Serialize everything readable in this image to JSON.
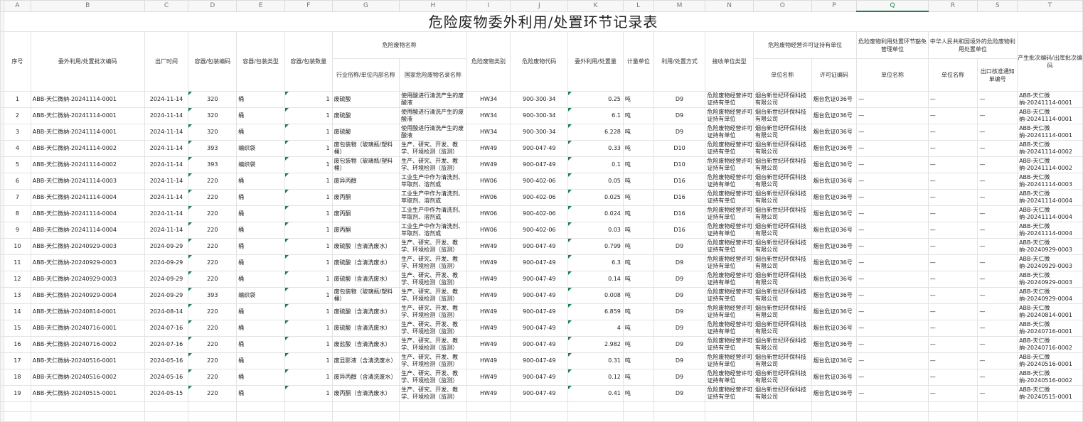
{
  "sheet": {
    "column_letters": [
      "A",
      "B",
      "C",
      "D",
      "E",
      "F",
      "G",
      "H",
      "I",
      "J",
      "K",
      "L",
      "M",
      "N",
      "O",
      "P",
      "Q",
      "R",
      "S",
      "T"
    ],
    "selected_column": "Q",
    "title": "危险废物委外利用/处置环节记录表"
  },
  "headers": {
    "seq": "序号",
    "batch": "委外利用/处置批次编码",
    "date": "出厂时间",
    "container_code": "容器/包装编码",
    "container_type": "容器/包装类型",
    "container_qty": "容器/包装数量",
    "waste_name_group": "危险废物名称",
    "industry_name": "行业俗称/单位内部名称",
    "national_name": "国家危险废物名录名称",
    "category": "危险废物类别",
    "code": "危险废物代码",
    "amount": "委外利用/处置量",
    "unit": "计量单位",
    "method": "利用/处置方式",
    "receiver_type": "接收单位类型",
    "license_group": "危险废物经营许可证持有单位",
    "license_unit_name": "单位名称",
    "license_no": "许可证编码",
    "exempt_group": "危险废物利用处置环节豁免管理单位",
    "exempt_unit_name": "单位名称",
    "foreign_group": "中华人民共和国境外的危险废物利用处置单位",
    "foreign_unit_name": "单位名称",
    "export_notice": "出口核准通知单编号",
    "production_batch": "产生批次编码/出库批次编码"
  },
  "rows": [
    {
      "seq": "1",
      "batch": "ABB-天仁微纳-20241114-0001",
      "date": "2024-11-14",
      "code_c": "320",
      "type": "桶",
      "qty": "1",
      "industry": "废硫酸",
      "national": "使用酸进行清洗产生的废酸液",
      "cat": "HW34",
      "wcode": "900-300-34",
      "amount": "0.25",
      "unit": "吨",
      "method": "D9",
      "receiver": "危险废物经营许可证持有单位",
      "lunit": "烟台新世纪环保科技有限公司",
      "lno": "烟台危证036号",
      "eunit": "—",
      "funit": "—",
      "notice": "—",
      "pbatch": "ABB-天仁微纳-20241114-0001"
    },
    {
      "seq": "2",
      "batch": "ABB-天仁微纳-20241114-0001",
      "date": "2024-11-14",
      "code_c": "320",
      "type": "桶",
      "qty": "1",
      "industry": "废硫酸",
      "national": "使用酸进行清洗产生的废酸液",
      "cat": "HW34",
      "wcode": "900-300-34",
      "amount": "6.1",
      "unit": "吨",
      "method": "D9",
      "receiver": "危险废物经营许可证持有单位",
      "lunit": "烟台新世纪环保科技有限公司",
      "lno": "烟台危证036号",
      "eunit": "—",
      "funit": "—",
      "notice": "—",
      "pbatch": "ABB-天仁微纳-20241114-0001"
    },
    {
      "seq": "3",
      "batch": "ABB-天仁微纳-20241114-0001",
      "date": "2024-11-14",
      "code_c": "320",
      "type": "桶",
      "qty": "1",
      "industry": "废硫酸",
      "national": "使用酸进行清洗产生的废酸液",
      "cat": "HW34",
      "wcode": "900-300-34",
      "amount": "6.228",
      "unit": "吨",
      "method": "D9",
      "receiver": "危险废物经营许可证持有单位",
      "lunit": "烟台新世纪环保科技有限公司",
      "lno": "烟台危证036号",
      "eunit": "—",
      "funit": "—",
      "notice": "—",
      "pbatch": "ABB-天仁微纳-20241114-0001"
    },
    {
      "seq": "4",
      "batch": "ABB-天仁微纳-20241114-0002",
      "date": "2024-11-14",
      "code_c": "393",
      "type": "编织袋",
      "qty": "1",
      "industry": "废包装物（玻璃瓶/塑料桶）",
      "national": "生产、研究、开发、教学、环境检测（监测）",
      "cat": "HW49",
      "wcode": "900-047-49",
      "amount": "0.33",
      "unit": "吨",
      "method": "D10",
      "receiver": "危险废物经营许可证持有单位",
      "lunit": "烟台新世纪环保科技有限公司",
      "lno": "烟台危证036号",
      "eunit": "—",
      "funit": "—",
      "notice": "—",
      "pbatch": "ABB-天仁微纳-20241114-0002"
    },
    {
      "seq": "5",
      "batch": "ABB-天仁微纳-20241114-0002",
      "date": "2024-11-14",
      "code_c": "393",
      "type": "编织袋",
      "qty": "1",
      "industry": "废包装物（玻璃瓶/塑料桶）",
      "national": "生产、研究、开发、教学、环境检测（监测）",
      "cat": "HW49",
      "wcode": "900-047-49",
      "amount": "0.1",
      "unit": "吨",
      "method": "D10",
      "receiver": "危险废物经营许可证持有单位",
      "lunit": "烟台新世纪环保科技有限公司",
      "lno": "烟台危证036号",
      "eunit": "—",
      "funit": "—",
      "notice": "—",
      "pbatch": "ABB-天仁微纳-20241114-0002"
    },
    {
      "seq": "6",
      "batch": "ABB-天仁微纳-20241114-0003",
      "date": "2024-11-14",
      "code_c": "220",
      "type": "桶",
      "qty": "1",
      "industry": "废异丙醇",
      "national": "工业生产中作为清洗剂、萃取剂、溶剂或",
      "cat": "HW06",
      "wcode": "900-402-06",
      "amount": "0.05",
      "unit": "吨",
      "method": "D16",
      "receiver": "危险废物经营许可证持有单位",
      "lunit": "烟台新世纪环保科技有限公司",
      "lno": "烟台危证036号",
      "eunit": "—",
      "funit": "—",
      "notice": "—",
      "pbatch": "ABB-天仁微纳-20241114-0003"
    },
    {
      "seq": "7",
      "batch": "ABB-天仁微纳-20241114-0004",
      "date": "2024-11-14",
      "code_c": "220",
      "type": "桶",
      "qty": "1",
      "industry": "废丙酮",
      "national": "工业生产中作为清洗剂、萃取剂、溶剂或",
      "cat": "HW06",
      "wcode": "900-402-06",
      "amount": "0.025",
      "unit": "吨",
      "method": "D16",
      "receiver": "危险废物经营许可证持有单位",
      "lunit": "烟台新世纪环保科技有限公司",
      "lno": "烟台危证036号",
      "eunit": "—",
      "funit": "—",
      "notice": "—",
      "pbatch": "ABB-天仁微纳-20241114-0004"
    },
    {
      "seq": "8",
      "batch": "ABB-天仁微纳-20241114-0004",
      "date": "2024-11-14",
      "code_c": "220",
      "type": "桶",
      "qty": "1",
      "industry": "废丙酮",
      "national": "工业生产中作为清洗剂、萃取剂、溶剂或",
      "cat": "HW06",
      "wcode": "900-402-06",
      "amount": "0.024",
      "unit": "吨",
      "method": "D16",
      "receiver": "危险废物经营许可证持有单位",
      "lunit": "烟台新世纪环保科技有限公司",
      "lno": "烟台危证036号",
      "eunit": "—",
      "funit": "—",
      "notice": "—",
      "pbatch": "ABB-天仁微纳-20241114-0004"
    },
    {
      "seq": "9",
      "batch": "ABB-天仁微纳-20241114-0004",
      "date": "2024-11-14",
      "code_c": "220",
      "type": "桶",
      "qty": "1",
      "industry": "废丙酮",
      "national": "工业生产中作为清洗剂、萃取剂、溶剂或",
      "cat": "HW06",
      "wcode": "900-402-06",
      "amount": "0.03",
      "unit": "吨",
      "method": "D16",
      "receiver": "危险废物经营许可证持有单位",
      "lunit": "烟台新世纪环保科技有限公司",
      "lno": "烟台危证036号",
      "eunit": "—",
      "funit": "—",
      "notice": "—",
      "pbatch": "ABB-天仁微纳-20241114-0004"
    },
    {
      "seq": "10",
      "batch": "ABB-天仁微纳-20240929-0003",
      "date": "2024-09-29",
      "code_c": "220",
      "type": "桶",
      "qty": "1",
      "industry": "废硫酸（含清洗废水）",
      "national": "生产、研究、开发、教学、环境检测（监测）",
      "cat": "HW49",
      "wcode": "900-047-49",
      "amount": "0.799",
      "unit": "吨",
      "method": "D9",
      "receiver": "危险废物经营许可证持有单位",
      "lunit": "烟台新世纪环保科技有限公司",
      "lno": "烟台危证036号",
      "eunit": "—",
      "funit": "—",
      "notice": "—",
      "pbatch": "ABB-天仁微纳-20240929-0003"
    },
    {
      "seq": "11",
      "batch": "ABB-天仁微纳-20240929-0003",
      "date": "2024-09-29",
      "code_c": "220",
      "type": "桶",
      "qty": "1",
      "industry": "废硫酸（含清洗废水）",
      "national": "生产、研究、开发、教学、环境检测（监测）",
      "cat": "HW49",
      "wcode": "900-047-49",
      "amount": "6.3",
      "unit": "吨",
      "method": "D9",
      "receiver": "危险废物经营许可证持有单位",
      "lunit": "烟台新世纪环保科技有限公司",
      "lno": "烟台危证036号",
      "eunit": "—",
      "funit": "—",
      "notice": "—",
      "pbatch": "ABB-天仁微纳-20240929-0003"
    },
    {
      "seq": "12",
      "batch": "ABB-天仁微纳-20240929-0003",
      "date": "2024-09-29",
      "code_c": "220",
      "type": "桶",
      "qty": "1",
      "industry": "废硫酸（含清洗废水）",
      "national": "生产、研究、开发、教学、环境检测（监测）",
      "cat": "HW49",
      "wcode": "900-047-49",
      "amount": "0.14",
      "unit": "吨",
      "method": "D9",
      "receiver": "危险废物经营许可证持有单位",
      "lunit": "烟台新世纪环保科技有限公司",
      "lno": "烟台危证036号",
      "eunit": "—",
      "funit": "—",
      "notice": "—",
      "pbatch": "ABB-天仁微纳-20240929-0003"
    },
    {
      "seq": "13",
      "batch": "ABB-天仁微纳-20240929-0004",
      "date": "2024-09-29",
      "code_c": "393",
      "type": "编织袋",
      "qty": "1",
      "industry": "废包装物（玻璃瓶/塑料桶）",
      "national": "生产、研究、开发、教学、环境检测（监测）",
      "cat": "HW49",
      "wcode": "900-047-49",
      "amount": "0.008",
      "unit": "吨",
      "method": "D9",
      "receiver": "危险废物经营许可证持有单位",
      "lunit": "烟台新世纪环保科技有限公司",
      "lno": "烟台危证036号",
      "eunit": "—",
      "funit": "—",
      "notice": "—",
      "pbatch": "ABB-天仁微纳-20240929-0004"
    },
    {
      "seq": "14",
      "batch": "ABB-天仁微纳-20240814-0001",
      "date": "2024-08-14",
      "code_c": "220",
      "type": "桶",
      "qty": "1",
      "industry": "废硫酸（含清洗废水）",
      "national": "生产、研究、开发、教学、环境检测（监测）",
      "cat": "HW49",
      "wcode": "900-047-49",
      "amount": "6.859",
      "unit": "吨",
      "method": "D9",
      "receiver": "危险废物经营许可证持有单位",
      "lunit": "烟台新世纪环保科技有限公司",
      "lno": "烟台危证036号",
      "eunit": "—",
      "funit": "—",
      "notice": "—",
      "pbatch": "ABB-天仁微纳-20240814-0001"
    },
    {
      "seq": "15",
      "batch": "ABB-天仁微纳-20240716-0001",
      "date": "2024-07-16",
      "code_c": "220",
      "type": "桶",
      "qty": "1",
      "industry": "废硫酸（含清洗废水）",
      "national": "生产、研究、开发、教学、环境检测（监测）",
      "cat": "HW49",
      "wcode": "900-047-49",
      "amount": "4",
      "unit": "吨",
      "method": "D9",
      "receiver": "危险废物经营许可证持有单位",
      "lunit": "烟台新世纪环保科技有限公司",
      "lno": "烟台危证036号",
      "eunit": "—",
      "funit": "—",
      "notice": "—",
      "pbatch": "ABB-天仁微纳-20240716-0001"
    },
    {
      "seq": "16",
      "batch": "ABB-天仁微纳-20240716-0002",
      "date": "2024-07-16",
      "code_c": "220",
      "type": "桶",
      "qty": "1",
      "industry": "废盐酸（含清洗废水）",
      "national": "生产、研究、开发、教学、环境检测（监测）",
      "cat": "HW49",
      "wcode": "900-047-49",
      "amount": "2.982",
      "unit": "吨",
      "method": "D9",
      "receiver": "危险废物经营许可证持有单位",
      "lunit": "烟台新世纪环保科技有限公司",
      "lno": "烟台危证036号",
      "eunit": "—",
      "funit": "—",
      "notice": "—",
      "pbatch": "ABB-天仁微纳-20240716-0002"
    },
    {
      "seq": "17",
      "batch": "ABB-天仁微纳-20240516-0001",
      "date": "2024-05-16",
      "code_c": "220",
      "type": "桶",
      "qty": "1",
      "industry": "废显影液（含清洗废水）",
      "national": "生产、研究、开发、教学、环境检测（监测）",
      "cat": "HW49",
      "wcode": "900-047-49",
      "amount": "0.31",
      "unit": "吨",
      "method": "D9",
      "receiver": "危险废物经营许可证持有单位",
      "lunit": "烟台新世纪环保科技有限公司",
      "lno": "烟台危证036号",
      "eunit": "—",
      "funit": "—",
      "notice": "—",
      "pbatch": "ABB-天仁微纳-20240516-0001"
    },
    {
      "seq": "18",
      "batch": "ABB-天仁微纳-20240516-0002",
      "date": "2024-05-16",
      "code_c": "220",
      "type": "桶",
      "qty": "1",
      "industry": "废异丙醇（含清洗废水）",
      "national": "生产、研究、开发、教学、环境检测（监测）",
      "cat": "HW49",
      "wcode": "900-047-49",
      "amount": "0.12",
      "unit": "吨",
      "method": "D9",
      "receiver": "危险废物经营许可证持有单位",
      "lunit": "烟台新世纪环保科技有限公司",
      "lno": "烟台危证036号",
      "eunit": "—",
      "funit": "—",
      "notice": "—",
      "pbatch": "ABB-天仁微纳-20240516-0002"
    },
    {
      "seq": "19",
      "batch": "ABB-天仁微纳-20240515-0001",
      "date": "2024-05-15",
      "code_c": "220",
      "type": "桶",
      "qty": "1",
      "industry": "废丙酮（含清洗废水）",
      "national": "生产、研究、开发、教学、环境检测（监测）",
      "cat": "HW49",
      "wcode": "900-047-49",
      "amount": "0.41",
      "unit": "吨",
      "method": "D9",
      "receiver": "危险废物经营许可证持有单位",
      "lunit": "烟台新世纪环保科技有限公司",
      "lno": "烟台危证036号",
      "eunit": "—",
      "funit": "—",
      "notice": "—",
      "pbatch": "ABB-天仁微纳-20240515-0001"
    }
  ],
  "colors": {
    "accent": "#1b7f4a",
    "gridline": "#e3e3e3",
    "header_bg": "#f7f7f7"
  }
}
